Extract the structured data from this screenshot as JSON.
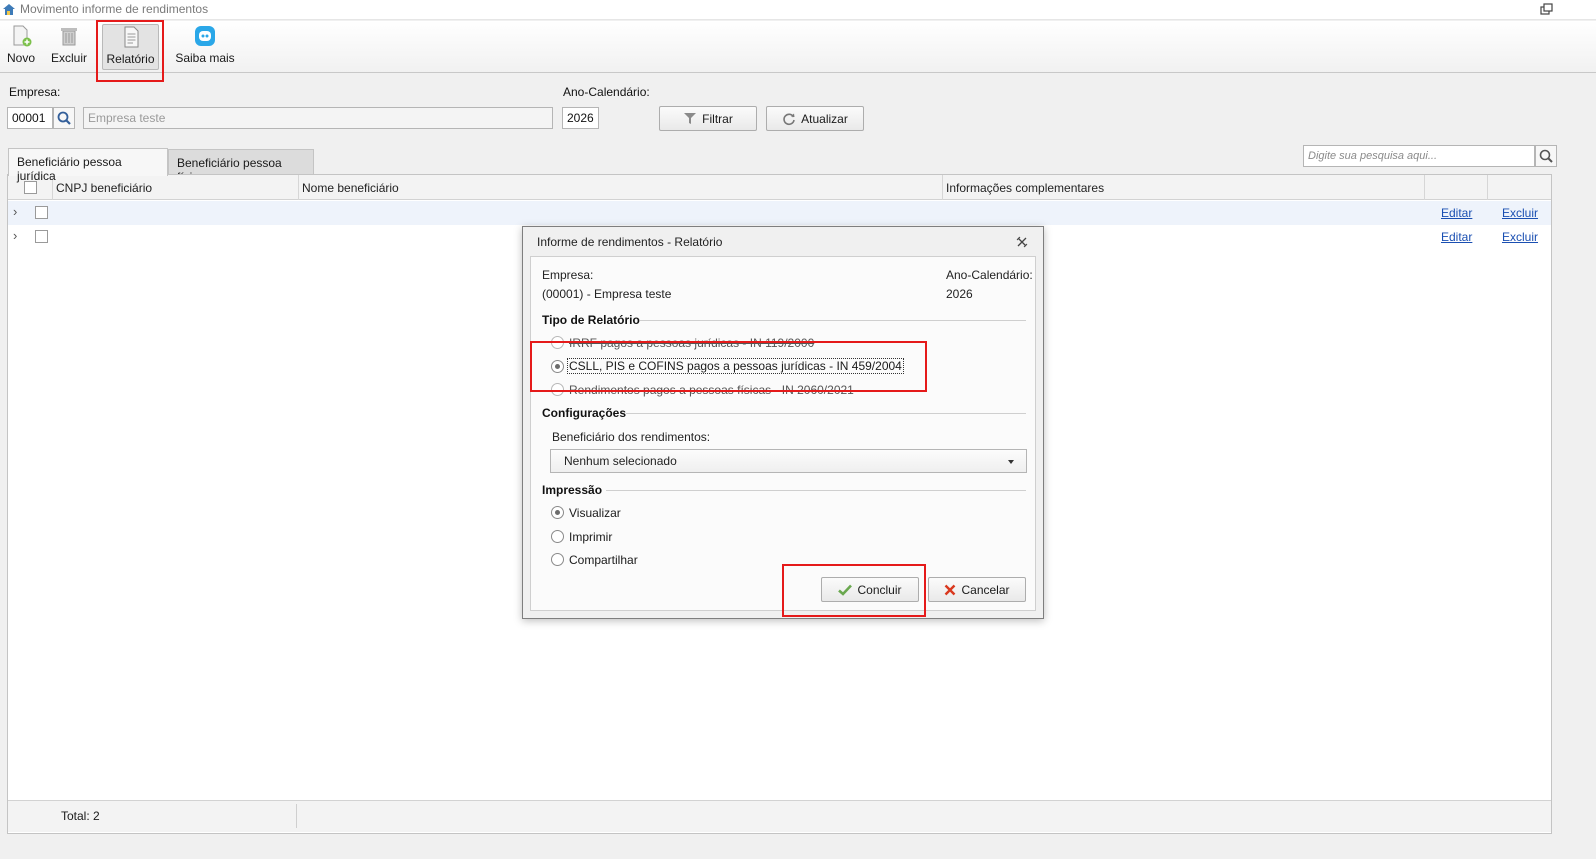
{
  "window": {
    "title": "Movimento informe de rendimentos"
  },
  "toolbar": {
    "novo": "Novo",
    "excluir": "Excluir",
    "relatorio": "Relatório",
    "saiba_mais": "Saiba mais"
  },
  "filters": {
    "empresa_label": "Empresa:",
    "empresa_code": "00001",
    "empresa_name_placeholder": "Empresa teste",
    "ano_label": "Ano-Calendário:",
    "ano_value": "2026",
    "filtrar": "Filtrar",
    "atualizar": "Atualizar"
  },
  "tabs": [
    {
      "label": "Beneficiário pessoa jurídica",
      "selected": true
    },
    {
      "label": "Beneficiário pessoa física",
      "selected": false
    }
  ],
  "search": {
    "placeholder": "Digite sua pesquisa aqui..."
  },
  "grid": {
    "columns": [
      "CNPJ beneficiário",
      "Nome beneficiário",
      "Informações complementares"
    ],
    "row_actions": {
      "edit": "Editar",
      "delete": "Excluir"
    },
    "rows": [
      {
        "cnpj": "",
        "nome": "",
        "info": ""
      },
      {
        "cnpj": "",
        "nome": "",
        "info": ""
      }
    ],
    "total_label": "Total: 2"
  },
  "dialog": {
    "title": "Informe de rendimentos - Relatório",
    "empresa_label": "Empresa:",
    "empresa_value": "(00001) - Empresa teste",
    "ano_label": "Ano-Calendário:",
    "ano_value": "2026",
    "tipo_title": "Tipo de Relatório",
    "tipo_options": [
      "IRRF pagos a pessoas jurídicas - IN 119/2000",
      "CSLL, PIS e COFINS pagos a pessoas jurídicas - IN 459/2004",
      "Rendimentos pagos a pessoas físicas - IN 2060/2021"
    ],
    "tipo_selected_index": 1,
    "config_title": "Configurações",
    "beneficiario_label": "Beneficiário dos rendimentos:",
    "beneficiario_value": "Nenhum selecionado",
    "impressao_title": "Impressão",
    "impressao_options": [
      "Visualizar",
      "Imprimir",
      "Compartilhar"
    ],
    "impressao_selected_index": 0,
    "concluir": "Concluir",
    "cancelar": "Cancelar"
  },
  "colors": {
    "highlight": "#e51a1a",
    "link": "#1a4fb2",
    "check_green": "#6aa84f",
    "cancel_red": "#d9381e",
    "saiba_blue": "#2aa7e8"
  }
}
